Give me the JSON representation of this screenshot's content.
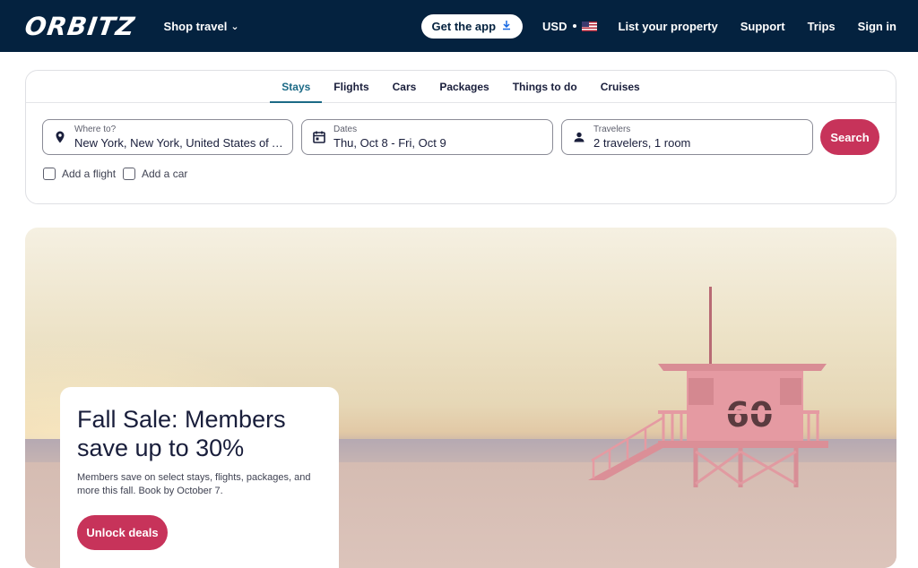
{
  "header": {
    "logo": "ORBITZ",
    "shop_travel": "Shop travel",
    "get_app": "Get the app",
    "currency": "USD",
    "links": [
      "List your property",
      "Support",
      "Trips",
      "Sign in"
    ]
  },
  "search": {
    "tabs": [
      "Stays",
      "Flights",
      "Cars",
      "Packages",
      "Things to do",
      "Cruises"
    ],
    "active_tab": "Stays",
    "where": {
      "label": "Where to?",
      "value": "New York, New York, United States of A..."
    },
    "dates": {
      "label": "Dates",
      "value": "Thu, Oct 8 - Fri, Oct 9"
    },
    "travelers": {
      "label": "Travelers",
      "value": "2 travelers, 1 room"
    },
    "search_button": "Search",
    "add_flight": "Add a flight",
    "add_car": "Add a car"
  },
  "hero": {
    "title": "Fall Sale: Members save up to 30%",
    "body": "Members save on select stays, flights, packages, and more this fall. Book by October 7.",
    "cta": "Unlock deals",
    "tower_number": "60"
  },
  "colors": {
    "header_bg": "#04223f",
    "accent": "#c7335a",
    "tab_active": "#1c6a86"
  }
}
